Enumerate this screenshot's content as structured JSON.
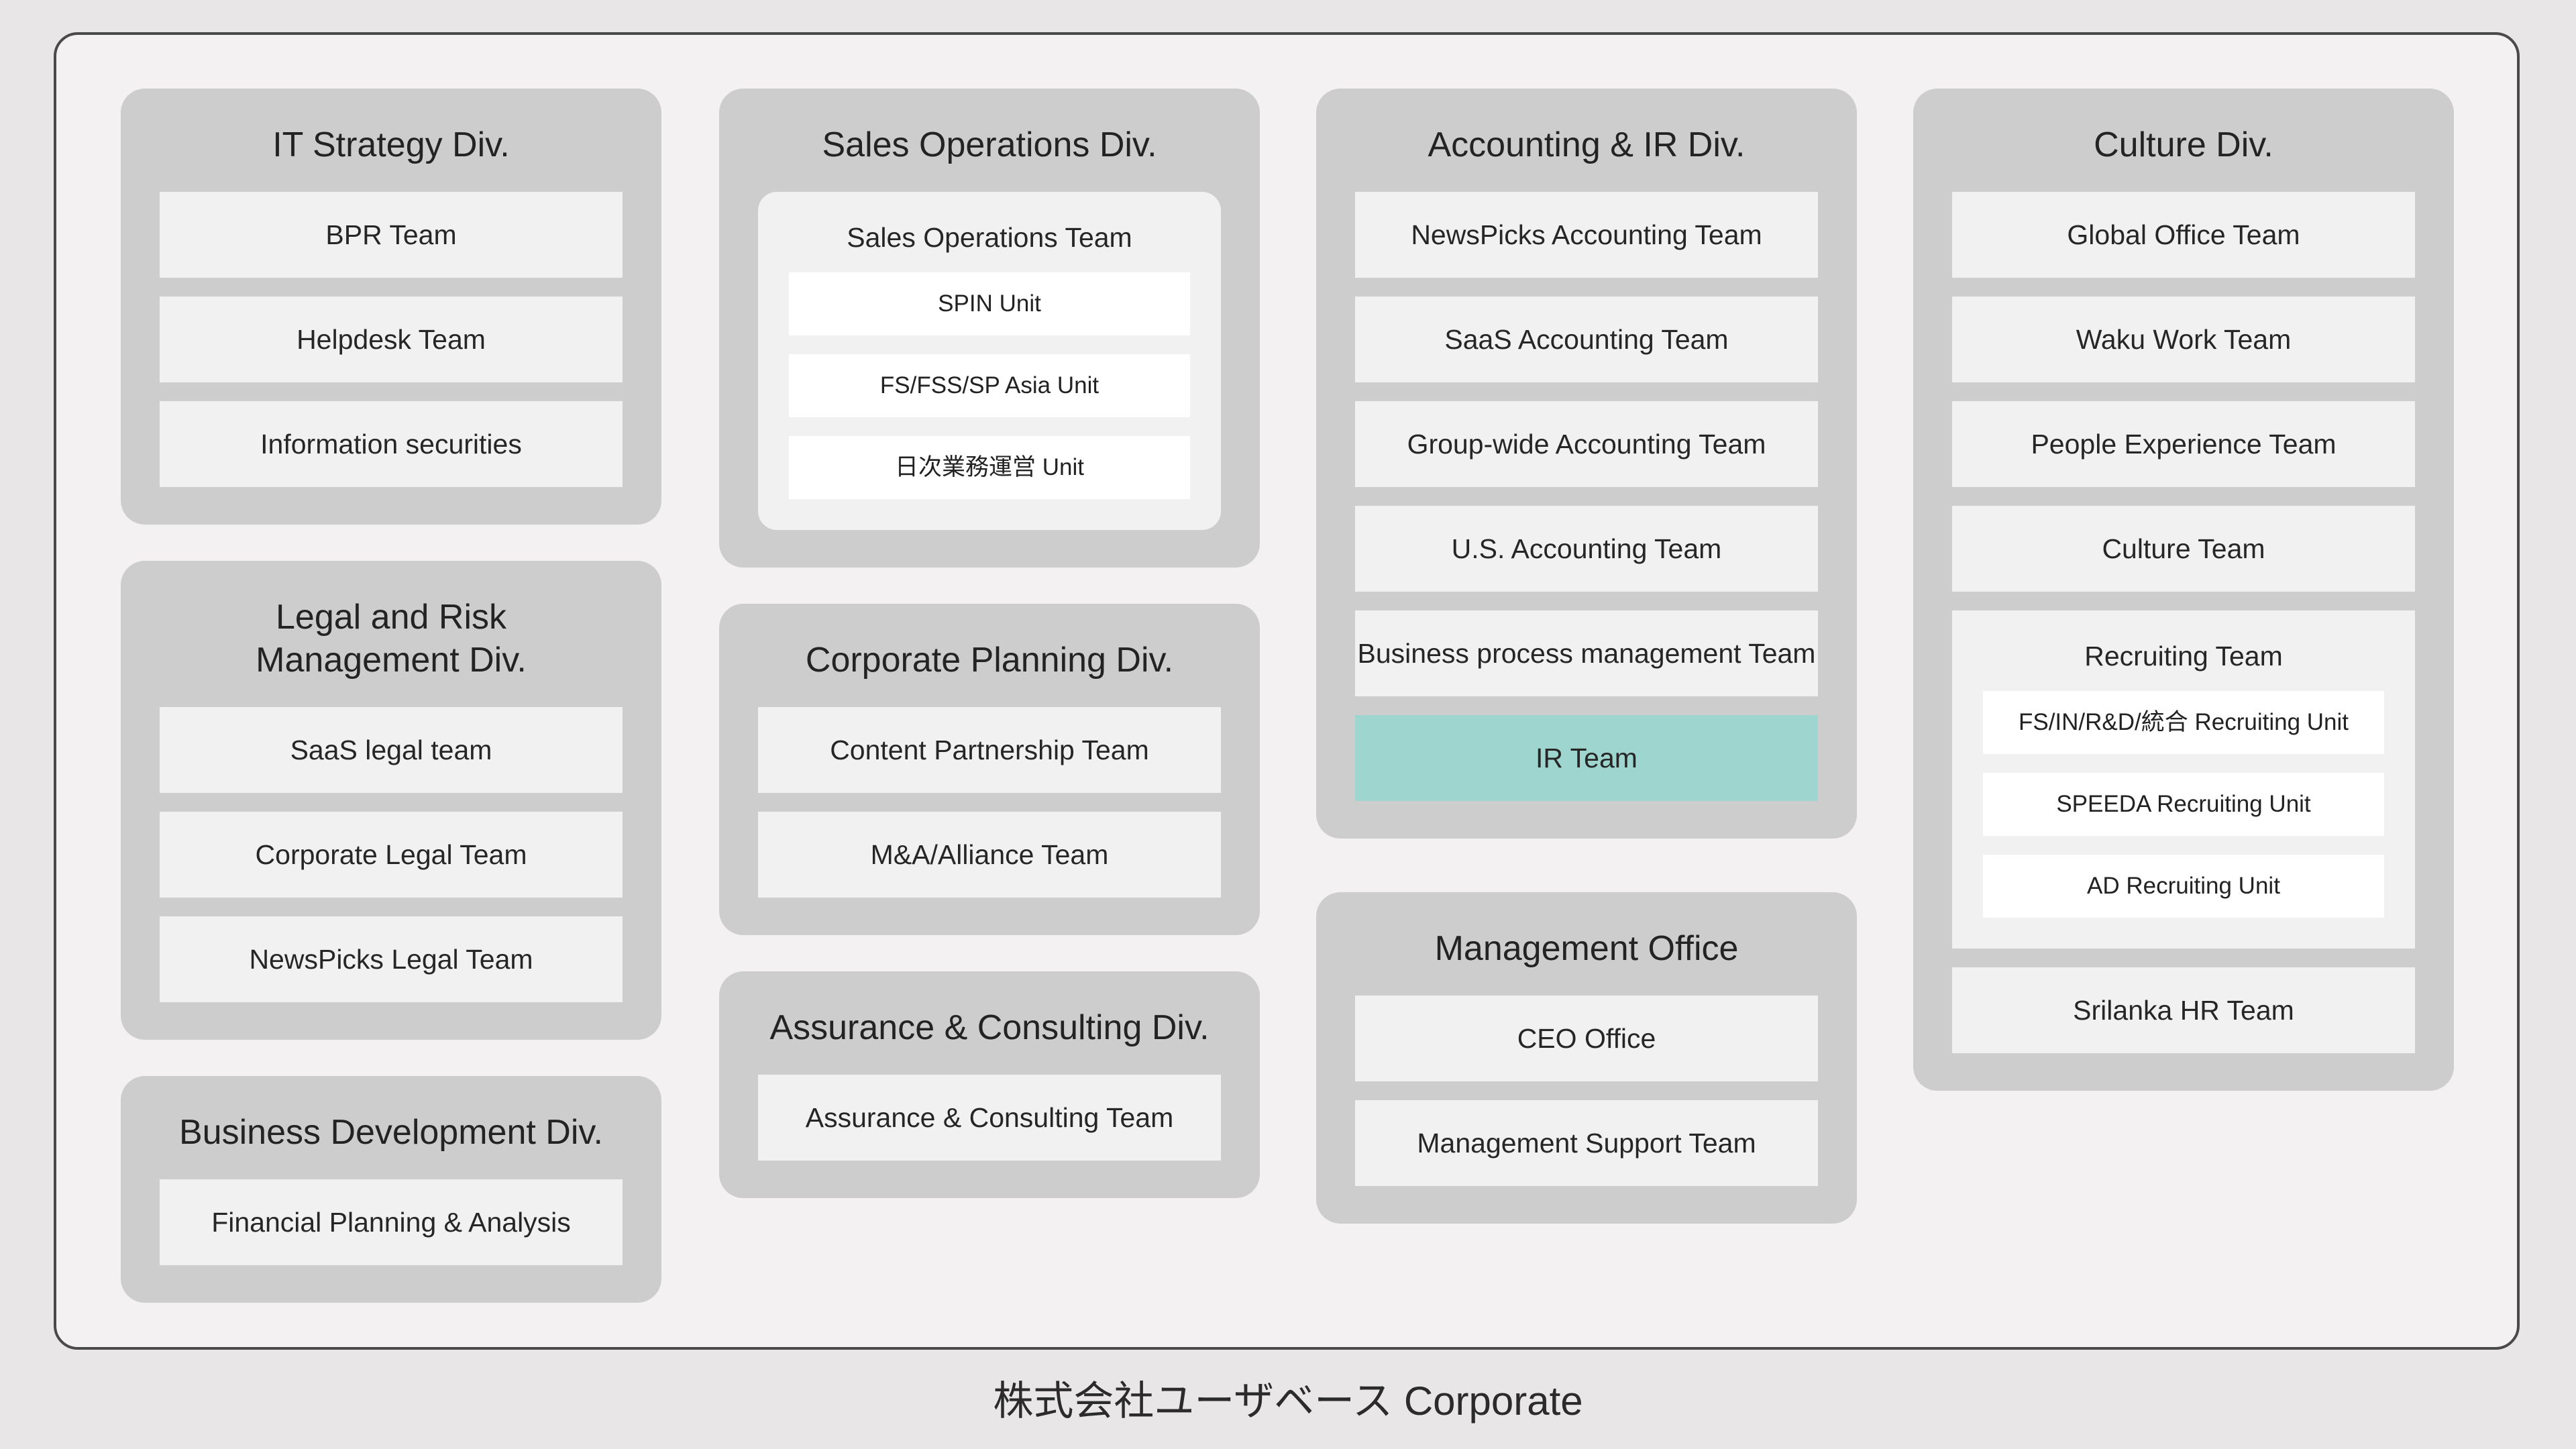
{
  "footer": "株式会社ユーザベース Corporate",
  "columns": [
    {
      "divisions": [
        {
          "title": "IT Strategy Div.",
          "teams": [
            "BPR Team",
            "Helpdesk Team",
            "Information securities"
          ]
        },
        {
          "title_lines": [
            "Legal and Risk",
            "Management Div."
          ],
          "teams": [
            "SaaS legal team",
            "Corporate Legal Team",
            "NewsPicks Legal Team"
          ]
        },
        {
          "title": "Business Development Div.",
          "teams": [
            "Financial Planning & Analysis"
          ]
        }
      ]
    },
    {
      "divisions": [
        {
          "title": "Sales Operations Div.",
          "group": {
            "title": "Sales Operations Team",
            "units": [
              "SPIN Unit",
              "FS/FSS/SP Asia Unit",
              "日次業務運営 Unit"
            ]
          }
        },
        {
          "title": "Corporate Planning Div.",
          "teams": [
            "Content Partnership Team",
            "M&A/Alliance Team"
          ]
        },
        {
          "title": "Assurance & Consulting Div.",
          "teams": [
            "Assurance & Consulting Team"
          ]
        }
      ]
    },
    {
      "divisions": [
        {
          "title": "Accounting & IR Div.",
          "teams": [
            "NewsPicks Accounting Team",
            "SaaS Accounting Team",
            "Group-wide Accounting Team",
            "U.S. Accounting Team",
            "Business process management Team",
            "IR Team"
          ],
          "highlight_color": "#9ed6cf"
        },
        {
          "title": "Management Office",
          "teams": [
            "CEO Office",
            "Management Support Team"
          ]
        }
      ]
    },
    {
      "divisions": [
        {
          "title": "Culture Div.",
          "teams_before": [
            "Global Office Team",
            "Waku Work Team",
            "People Experience Team",
            "Culture Team"
          ],
          "group": {
            "title": "Recruiting Team",
            "units": [
              "FS/IN/R&D/統合 Recruiting Unit",
              "SPEEDA Recruiting  Unit",
              "AD Recruiting Unit"
            ]
          },
          "teams_after": [
            "Srilanka HR Team"
          ]
        }
      ]
    }
  ]
}
